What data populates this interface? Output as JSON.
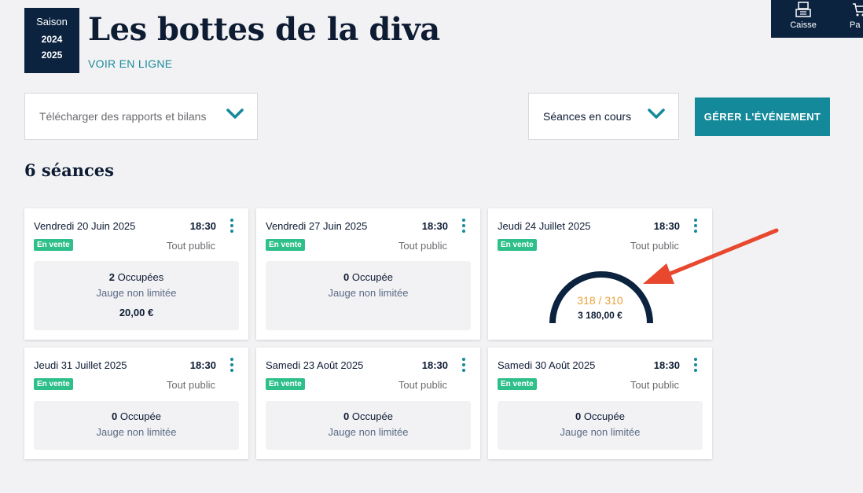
{
  "season": {
    "label": "Saison",
    "year_start": "2024",
    "year_end": "2025"
  },
  "event": {
    "title": "Les bottes de la diva",
    "online_link": "VOIR EN LIGNE"
  },
  "topbar": {
    "items": [
      {
        "label": "Caisse",
        "icon": "cash-register-icon"
      },
      {
        "label": "Pa",
        "icon": "cart-icon"
      }
    ]
  },
  "toolbar": {
    "reports_dropdown": "Télécharger des rapports et bilans",
    "sessions_dropdown": "Séances en cours",
    "manage_button": "GÉRER L'ÉVÉNEMENT"
  },
  "sessions_title": "6 séances",
  "sessions": [
    {
      "date": "Vendredi 20 Juin 2025",
      "time": "18:30",
      "status": "En vente",
      "audience": "Tout public",
      "occupied_count": "2",
      "occupied_label": "Occupées",
      "capacity": "Jauge non limitée",
      "price": "20,00 €"
    },
    {
      "date": "Vendredi 27 Juin 2025",
      "time": "18:30",
      "status": "En vente",
      "audience": "Tout public",
      "occupied_count": "0",
      "occupied_label": "Occupée",
      "capacity": "Jauge non limitée"
    },
    {
      "date": "Jeudi 24 Juillet 2025",
      "time": "18:30",
      "status": "En vente",
      "audience": "Tout public",
      "gauge": {
        "sold": 318,
        "total": 310,
        "text": "318 / 310",
        "amount": "3 180,00 €"
      }
    },
    {
      "date": "Jeudi 31 Juillet 2025",
      "time": "18:30",
      "status": "En vente",
      "audience": "Tout public",
      "occupied_count": "0",
      "occupied_label": "Occupée",
      "capacity": "Jauge non limitée"
    },
    {
      "date": "Samedi 23 Août 2025",
      "time": "18:30",
      "status": "En vente",
      "audience": "Tout public",
      "occupied_count": "0",
      "occupied_label": "Occupée",
      "capacity": "Jauge non limitée"
    },
    {
      "date": "Samedi 30 Août 2025",
      "time": "18:30",
      "status": "En vente",
      "audience": "Tout public",
      "occupied_count": "0",
      "occupied_label": "Occupée",
      "capacity": "Jauge non limitée"
    }
  ],
  "colors": {
    "navy": "#0c2340",
    "teal": "#13899a",
    "green_badge": "#2ebf8a",
    "gauge_text": "#e8a33a",
    "annotation_arrow": "#e8482e"
  }
}
